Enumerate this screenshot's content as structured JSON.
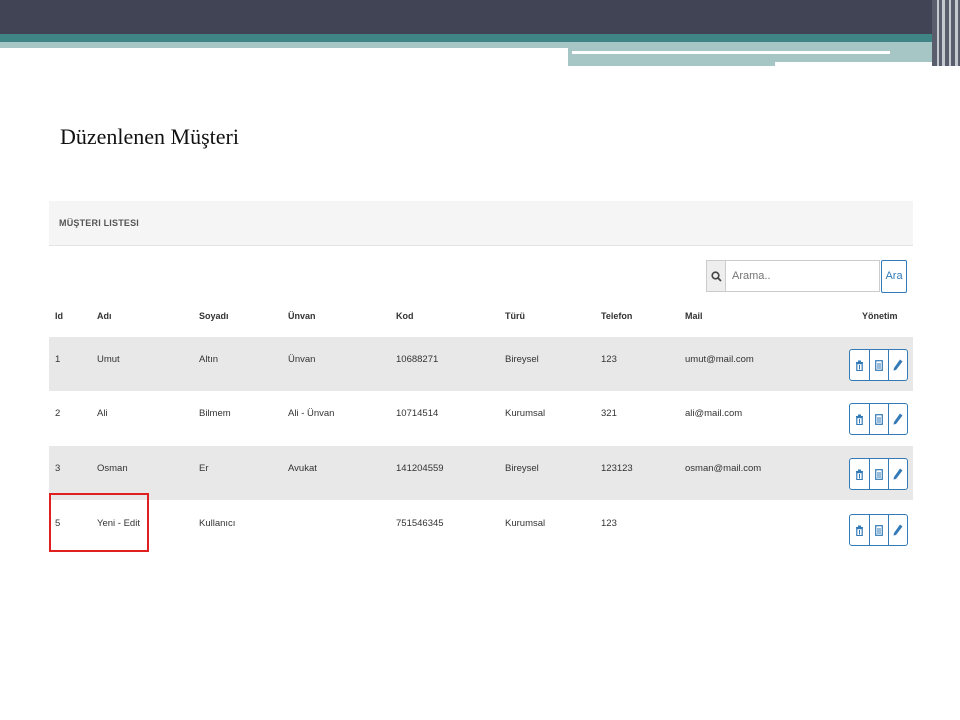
{
  "slide": {
    "title": "Düzenlenen Müşteri"
  },
  "panel": {
    "title": "MÜŞTERI LISTESI"
  },
  "search": {
    "placeholder": "Arama..",
    "value": "",
    "button_label": "Ara",
    "icon": "search-icon"
  },
  "table": {
    "headers": [
      "Id",
      "Adı",
      "Soyadı",
      "Ünvan",
      "Kod",
      "Türü",
      "Telefon",
      "Mail",
      "Yönetim"
    ],
    "rows": [
      {
        "id": "1",
        "adi": "Umut",
        "soyadi": "Altın",
        "unvan": "Ünvan",
        "kod": "10688271",
        "turu": "Bireysel",
        "telefon": "123",
        "mail": "umut@mail.com"
      },
      {
        "id": "2",
        "adi": "Ali",
        "soyadi": "Bilmem",
        "unvan": "Ali - Ünvan",
        "kod": "10714514",
        "turu": "Kurumsal",
        "telefon": "321",
        "mail": "ali@mail.com"
      },
      {
        "id": "3",
        "adi": "Osman",
        "soyadi": "Er",
        "unvan": "Avukat",
        "kod": "141204559",
        "turu": "Bireysel",
        "telefon": "123123",
        "mail": "osman@mail.com"
      },
      {
        "id": "5",
        "adi": "Yeni - Edit",
        "soyadi": "Kullanıcı",
        "unvan": "",
        "kod": "751546345",
        "turu": "Kurumsal",
        "telefon": "123",
        "mail": ""
      }
    ],
    "actions": {
      "icons": [
        "trash-icon",
        "document-icon",
        "pencil-icon"
      ]
    }
  },
  "colors": {
    "accent": "#337ab7",
    "highlight": "#e02020",
    "header_dark": "#414455",
    "header_teal": "#3f8585"
  }
}
